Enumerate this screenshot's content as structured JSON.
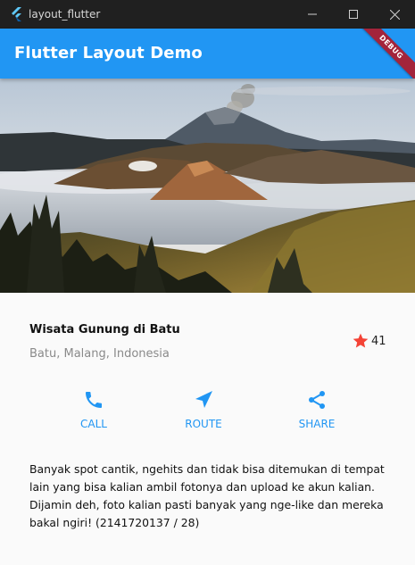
{
  "window": {
    "title": "layout_flutter"
  },
  "appbar": {
    "title": "Flutter Layout Demo",
    "debug_banner": "DEBUG"
  },
  "place": {
    "title": "Wisata Gunung di Batu",
    "location": "Batu, Malang, Indonesia",
    "favorite_count": "41"
  },
  "actions": [
    {
      "label": "CALL",
      "icon": "phone-icon"
    },
    {
      "label": "ROUTE",
      "icon": "navigation-icon"
    },
    {
      "label": "SHARE",
      "icon": "share-icon"
    }
  ],
  "description": "Banyak spot cantik, ngehits dan tidak bisa ditemukan di tempat lain yang bisa kalian ambil fotonya dan upload ke akun kalian. Dijamin deh, foto kalian pasti banyak yang nge-like dan mereka bakal ngiri! (2141720137 / 28)",
  "colors": {
    "primary": "#2196f3",
    "star": "#f44336",
    "titlebar": "#202020",
    "debug": "#a3243b"
  }
}
